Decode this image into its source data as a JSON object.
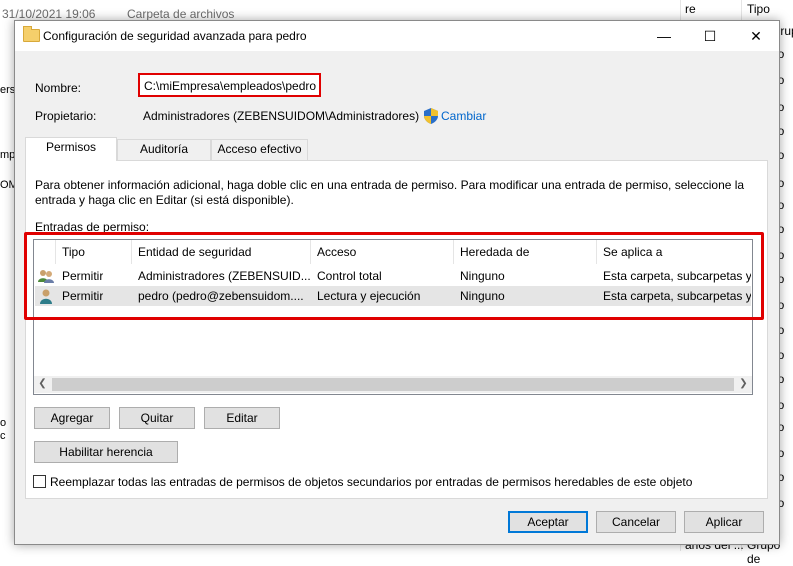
{
  "background": {
    "date": "31/10/2021 19:06",
    "type": "Carpeta de archivos",
    "col_partial": "re",
    "col_tipo": "Tipo",
    "right_items": [
      "Grupo",
      "rio",
      "rio",
      "rio",
      "rio",
      "rio",
      "rio",
      "rio",
      "rio",
      "rio",
      "rio",
      "rio",
      "rio",
      "rio",
      "rio",
      "rio",
      "rio",
      "rio",
      "rio",
      "rio",
      "rio",
      "rio",
      "rio",
      "rio",
      "Grupo de"
    ],
    "bottom_partial": "arios del ...",
    "left_fragments": [
      "ersi",
      "",
      "mpr",
      "OM",
      "",
      "",
      "o",
      "c"
    ]
  },
  "dialog": {
    "title": "Configuración de seguridad avanzada para pedro",
    "minimize": "—",
    "maximize": "☐",
    "close": "✕",
    "name_label": "Nombre:",
    "name_value": "C:\\miEmpresa\\empleados\\pedro",
    "owner_label": "Propietario:",
    "owner_value": "Administradores (ZEBENSUIDOM\\Administradores)",
    "change_link": "Cambiar",
    "tabs": [
      "Permisos",
      "Auditoría",
      "Acceso efectivo"
    ],
    "info_text": "Para obtener información adicional, haga doble clic en una entrada de permiso. Para modificar una entrada de permiso, seleccione la entrada y haga clic en Editar (si está disponible).",
    "entries_label": "Entradas de permiso:",
    "columns": [
      "Tipo",
      "Entidad de seguridad",
      "Acceso",
      "Heredada de",
      "Se aplica a"
    ],
    "rows": [
      {
        "icon": "group-users-icon",
        "tipo": "Permitir",
        "entidad": "Administradores (ZEBENSUID...",
        "acceso": "Control total",
        "heredada": "Ninguno",
        "aplica": "Esta carpeta, subcarpetas y a"
      },
      {
        "icon": "user-icon",
        "tipo": "Permitir",
        "entidad": "pedro (pedro@zebensuidom....",
        "acceso": "Lectura y ejecución",
        "heredada": "Ninguno",
        "aplica": "Esta carpeta, subcarpetas y a"
      }
    ],
    "buttons": {
      "add": "Agregar",
      "remove": "Quitar",
      "edit": "Editar",
      "inherit": "Habilitar herencia"
    },
    "replace_checkbox": "Reemplazar todas las entradas de permisos de objetos secundarios por entradas de permisos heredables de este objeto",
    "footer": {
      "ok": "Aceptar",
      "cancel": "Cancelar",
      "apply": "Aplicar"
    }
  },
  "colors": {
    "highlight": "#e00000",
    "link": "#0066cc",
    "accent": "#0078d7"
  }
}
